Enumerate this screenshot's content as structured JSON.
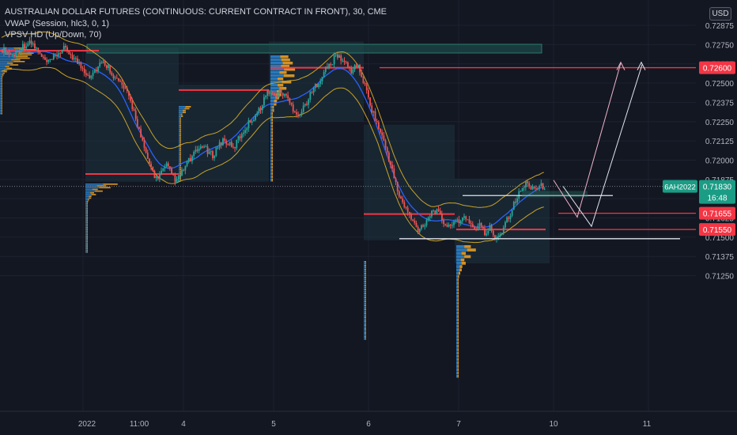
{
  "chart_data": {
    "type": "candlestick",
    "title": "AUSTRALIAN DOLLAR FUTURES (CONTINUOUS: CURRENT CONTRACT IN FRONT), 30, CME",
    "indicators": [
      "VWAP (Session, hlc3, 0, 1)",
      "VPSV HD (Up/Down, 70)"
    ],
    "currency": "USD",
    "ylim": [
      0.71175,
      0.7285
    ],
    "y_ticks": [
      "0.72875",
      "0.72750",
      "0.72625",
      "0.72500",
      "0.72375",
      "0.72250",
      "0.72125",
      "0.72000",
      "0.71875",
      "0.71750",
      "0.71625",
      "0.71500",
      "0.71375",
      "0.71250"
    ],
    "x_ticks": [
      "2022",
      "11:00",
      "4",
      "5",
      "6",
      "7",
      "10",
      "11"
    ],
    "last_price": {
      "symbol": "6AH2022",
      "value": "0.71830",
      "countdown": "16:48"
    },
    "levels": [
      "0.72600",
      "0.71655",
      "0.71550"
    ],
    "profiles": [
      {
        "poc": 0.7191
      },
      {
        "poc": 0.72455
      },
      {
        "poc": 0.726
      },
      {
        "poc": 0.7165
      },
      {
        "poc": 0.7155
      }
    ],
    "close_path": [
      0.7272,
      0.727,
      0.7268,
      0.7271,
      0.7274,
      0.7276,
      0.7275,
      0.727,
      0.7265,
      0.7263,
      0.7266,
      0.727,
      0.7272,
      0.727,
      0.7266,
      0.7262,
      0.7258,
      0.7255,
      0.7258,
      0.7262,
      0.7263,
      0.7259,
      0.7253,
      0.725,
      0.7245,
      0.7238,
      0.7228,
      0.7215,
      0.7203,
      0.7195,
      0.7188,
      0.7192,
      0.7196,
      0.7191,
      0.7186,
      0.7192,
      0.7198,
      0.7202,
      0.7206,
      0.721,
      0.7205,
      0.7203,
      0.7209,
      0.7213,
      0.7211,
      0.7207,
      0.7214,
      0.7219,
      0.7224,
      0.7228,
      0.7232,
      0.724,
      0.7245,
      0.7241,
      0.7244,
      0.7243,
      0.7237,
      0.7232,
      0.723,
      0.7236,
      0.7242,
      0.7248,
      0.7253,
      0.7259,
      0.7262,
      0.7268,
      0.7266,
      0.7262,
      0.7258,
      0.7262,
      0.7255,
      0.7244,
      0.7233,
      0.7224,
      0.7215,
      0.7205,
      0.7193,
      0.718,
      0.7172,
      0.7166,
      0.716,
      0.7155,
      0.7158,
      0.7163,
      0.7168,
      0.7165,
      0.716,
      0.7156,
      0.7162,
      0.7158,
      0.7164,
      0.716,
      0.7155,
      0.7158,
      0.7152,
      0.7156,
      0.715,
      0.7152,
      0.716,
      0.7166,
      0.7174,
      0.718,
      0.7185,
      0.7183,
      0.7182,
      0.7183
    ]
  }
}
